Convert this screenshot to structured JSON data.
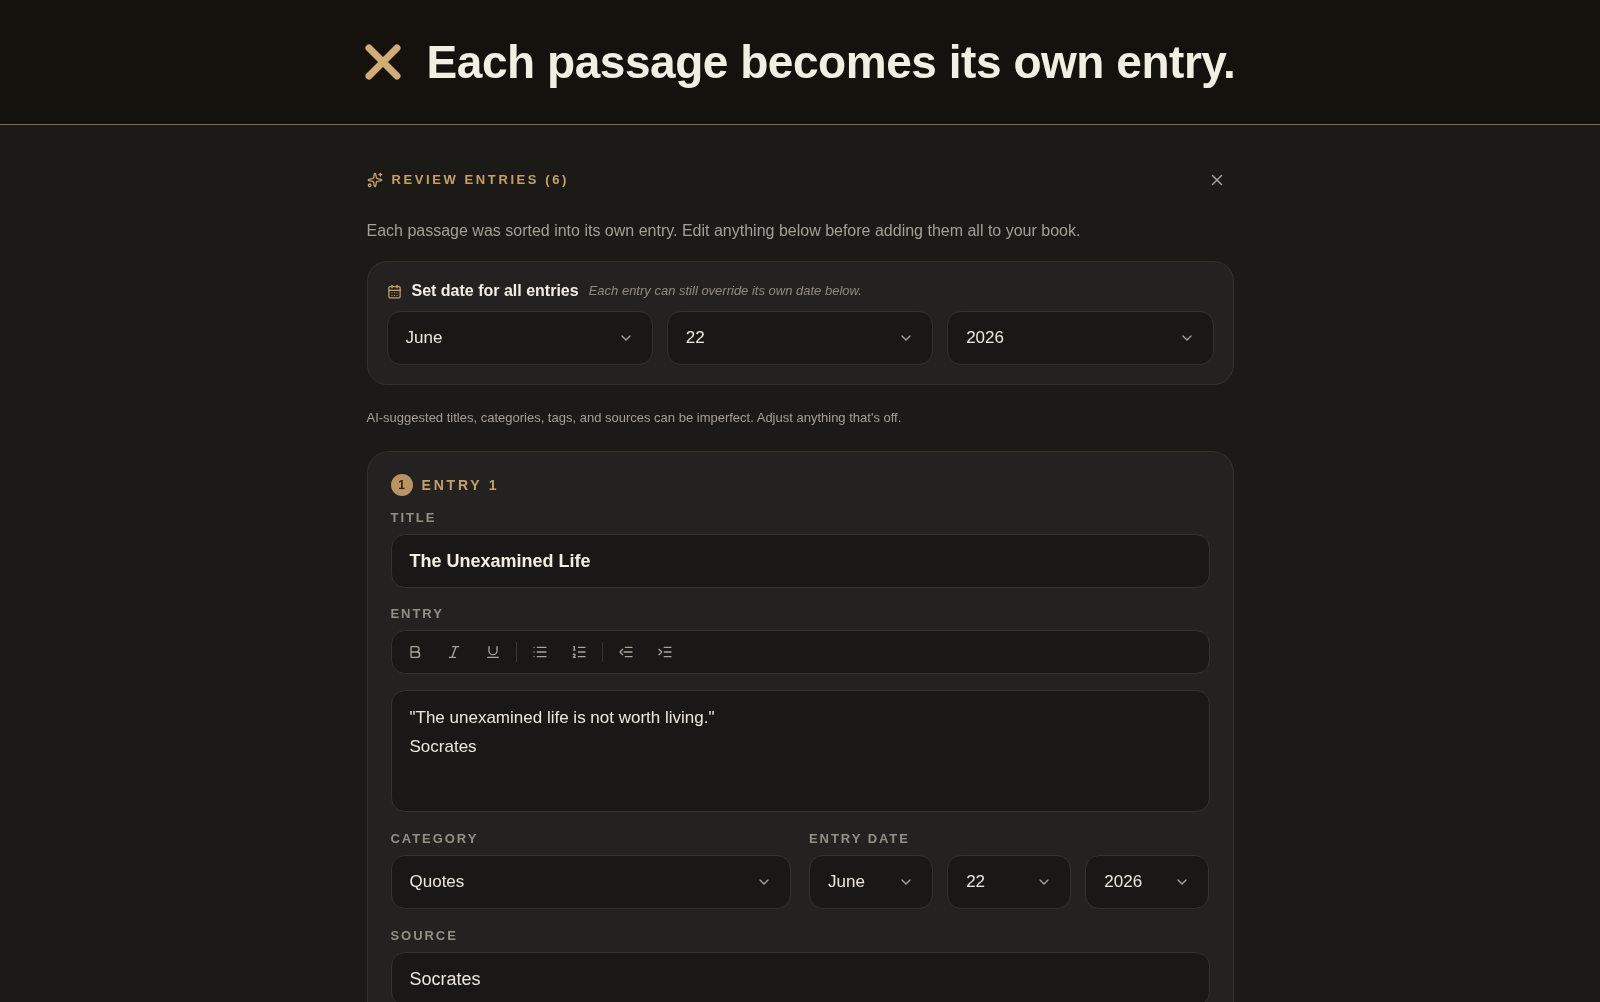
{
  "header": {
    "title": "Each passage becomes its own entry."
  },
  "panel": {
    "heading": "REVIEW ENTRIES (6)",
    "description": "Each passage was sorted into its own entry. Edit anything below before adding them all to your book.",
    "bulk_date": {
      "label": "Set date for all entries",
      "hint": "Each entry can still override its own date below.",
      "month": "June",
      "day": "22",
      "year": "2026"
    },
    "ai_note": "AI-suggested titles, categories, tags, and sources can be imperfect. Adjust anything that's off.",
    "entries": [
      {
        "number": "1",
        "heading": "ENTRY 1",
        "title_label": "TITLE",
        "title": "The Unexamined Life",
        "entry_label": "ENTRY",
        "body": "\"The unexamined life is not worth living.\"\nSocrates",
        "category_label": "CATEGORY",
        "category": "Quotes",
        "date_label": "ENTRY DATE",
        "month": "June",
        "day": "22",
        "year": "2026",
        "source_label": "SOURCE",
        "source": "Socrates"
      }
    ]
  }
}
